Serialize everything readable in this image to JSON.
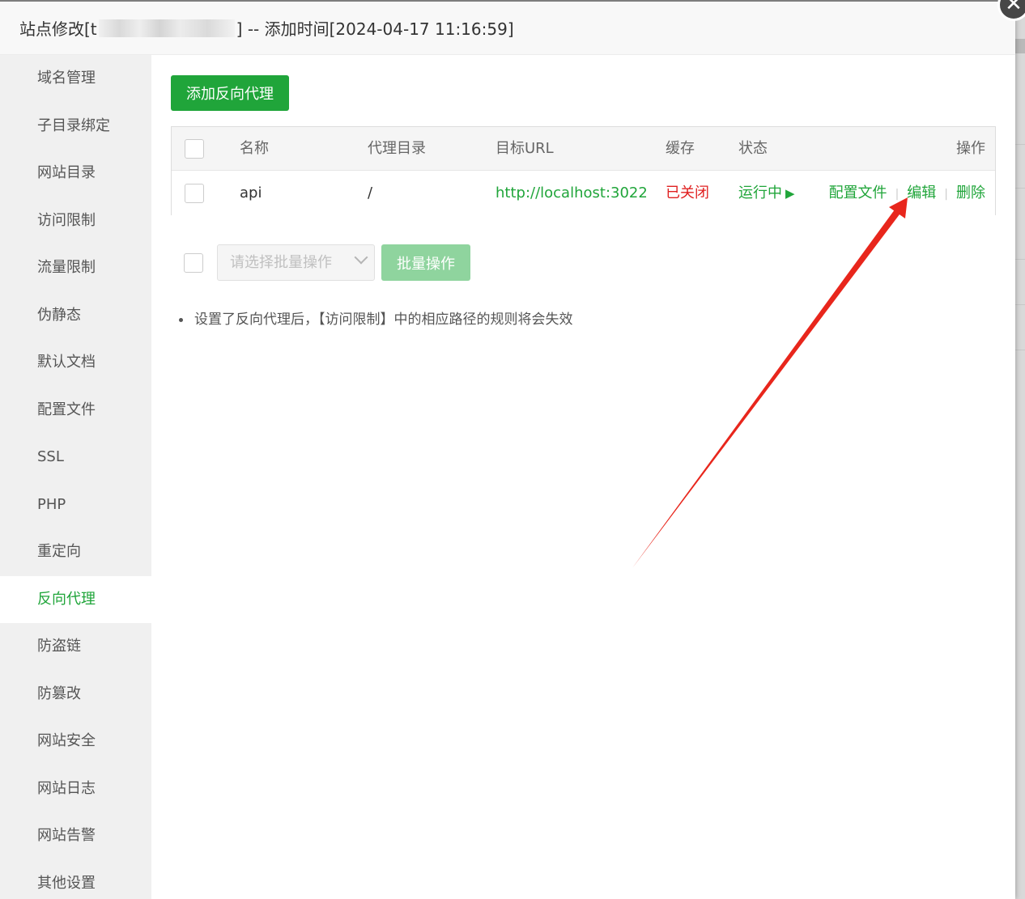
{
  "dialog": {
    "title_prefix": "站点修改[t",
    "title_suffix": "] -- 添加时间[2024-04-17 11:16:59]",
    "close_glyph": "✕"
  },
  "sidebar": {
    "items": [
      {
        "label": "域名管理"
      },
      {
        "label": "子目录绑定"
      },
      {
        "label": "网站目录"
      },
      {
        "label": "访问限制"
      },
      {
        "label": "流量限制"
      },
      {
        "label": "伪静态"
      },
      {
        "label": "默认文档"
      },
      {
        "label": "配置文件"
      },
      {
        "label": "SSL"
      },
      {
        "label": "PHP"
      },
      {
        "label": "重定向"
      },
      {
        "label": "反向代理"
      },
      {
        "label": "防盗链"
      },
      {
        "label": "防篡改"
      },
      {
        "label": "网站安全"
      },
      {
        "label": "网站日志"
      },
      {
        "label": "网站告警"
      },
      {
        "label": "其他设置"
      }
    ],
    "active": "反向代理"
  },
  "toolbar": {
    "add_label": "添加反向代理"
  },
  "table": {
    "headers": {
      "name": "名称",
      "path": "代理目录",
      "target": "目标URL",
      "cache": "缓存",
      "status": "状态",
      "ops": "操作"
    },
    "rows": [
      {
        "name": "api",
        "path": "/",
        "target": "http://localhost:3022",
        "cache": "已关闭",
        "status": "运行中",
        "status_icon": "play-icon",
        "op_config": "配置文件",
        "op_edit": "编辑",
        "op_delete": "删除"
      }
    ]
  },
  "batch": {
    "select_placeholder": "请选择批量操作",
    "button_label": "批量操作"
  },
  "tips": {
    "text": "设置了反向代理后，【访问限制】中的相应路径的规则将会失效"
  },
  "colors": {
    "accent": "#20a53a",
    "danger": "#e02020",
    "annotation_arrow": "#e8261c"
  }
}
